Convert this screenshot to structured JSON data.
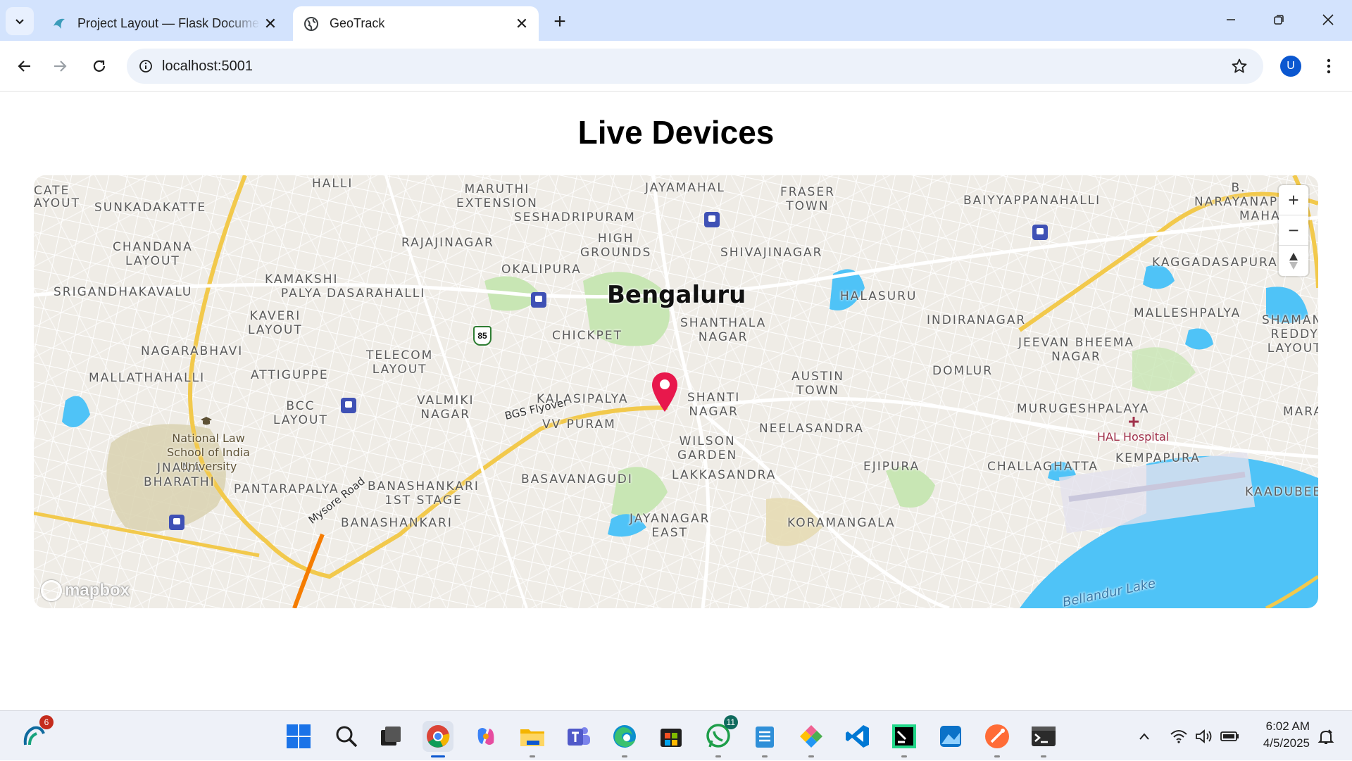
{
  "browser": {
    "tabs": [
      {
        "title": "Project Layout — Flask Documentation",
        "active": false,
        "favicon": "flask-icon"
      },
      {
        "title": "GeoTrack",
        "active": true,
        "favicon": "globe-icon"
      }
    ],
    "url": "localhost:5001",
    "profile_initial": "U"
  },
  "page": {
    "title": "Live Devices"
  },
  "map": {
    "city": "Bengaluru",
    "attribution": "mapbox",
    "colors": {
      "land": "#efece6",
      "water": "#4fc3f7",
      "park": "#c8e6b4",
      "road_major": "#f2c94c",
      "marker": "#e8184c"
    },
    "labels": [
      "HALLI",
      "MARUTHI EXTENSION",
      "JAYAMAHAL",
      "FRASER TOWN",
      "BAIYYAPPANAHALLI",
      "NARAYANAPURA",
      "SUNKADAKATTE",
      "SESHADRIPURAM",
      "CHANDANA LAYOUT",
      "RAJAJINAGAR",
      "HIGH GROUNDS",
      "SHIVAJINAGAR",
      "KAGGADASAPURA",
      "KAMAKSHI PALYA",
      "OKALIPURA",
      "SRIGANDHAKAVALU",
      "DASARAHALLI",
      "HALASURU",
      "KAVERI LAYOUT",
      "INDIRANAGAR",
      "MALLESHPALYA",
      "SHANTHALA NAGAR",
      "CHICKPET",
      "JEEVAN BHEEMA NAGAR",
      "NAGARABHAVI",
      "TELECOM LAYOUT",
      "MALLATHAHALLI",
      "ATTIGUPPE",
      "AUSTIN TOWN",
      "DOMLUR",
      "SHANTI NAGAR",
      "KALASIPALYA",
      "VALMIKI NAGAR",
      "BCC LAYOUT",
      "MURUGESHPALAYA",
      "VV PURAM",
      "NEELASANDRA",
      "WILSON GARDEN",
      "JNANA BHARATHI",
      "PANTARAPALYA",
      "EJIPURA",
      "CHALLAGHATTA",
      "KEMPAPURA",
      "BASAVANAGUDI",
      "BANASHANKARI 1ST STAGE",
      "LAKKASANDRA",
      "KAADUBEE",
      "BANASHANKARI",
      "JAYANAGAR EAST",
      "KORAMANGALA",
      "SHAMANI REDDY LAYOUT",
      "MAHA",
      "MARA",
      "CATE",
      "AYOUT"
    ],
    "poi": {
      "law_school": "National Law School of India University",
      "hospital": "HAL Hospital"
    },
    "roads": {
      "flyover": "BGS Flyover",
      "mysore_road": "Mysore Road",
      "route": "85"
    },
    "lake": "Bellandur Lake",
    "controls": {
      "zoom_in": "+",
      "zoom_out": "−"
    }
  },
  "taskbar": {
    "badges": {
      "weather": "6",
      "whatsapp": "11"
    },
    "time": "6:02 AM",
    "date": "4/5/2025"
  }
}
